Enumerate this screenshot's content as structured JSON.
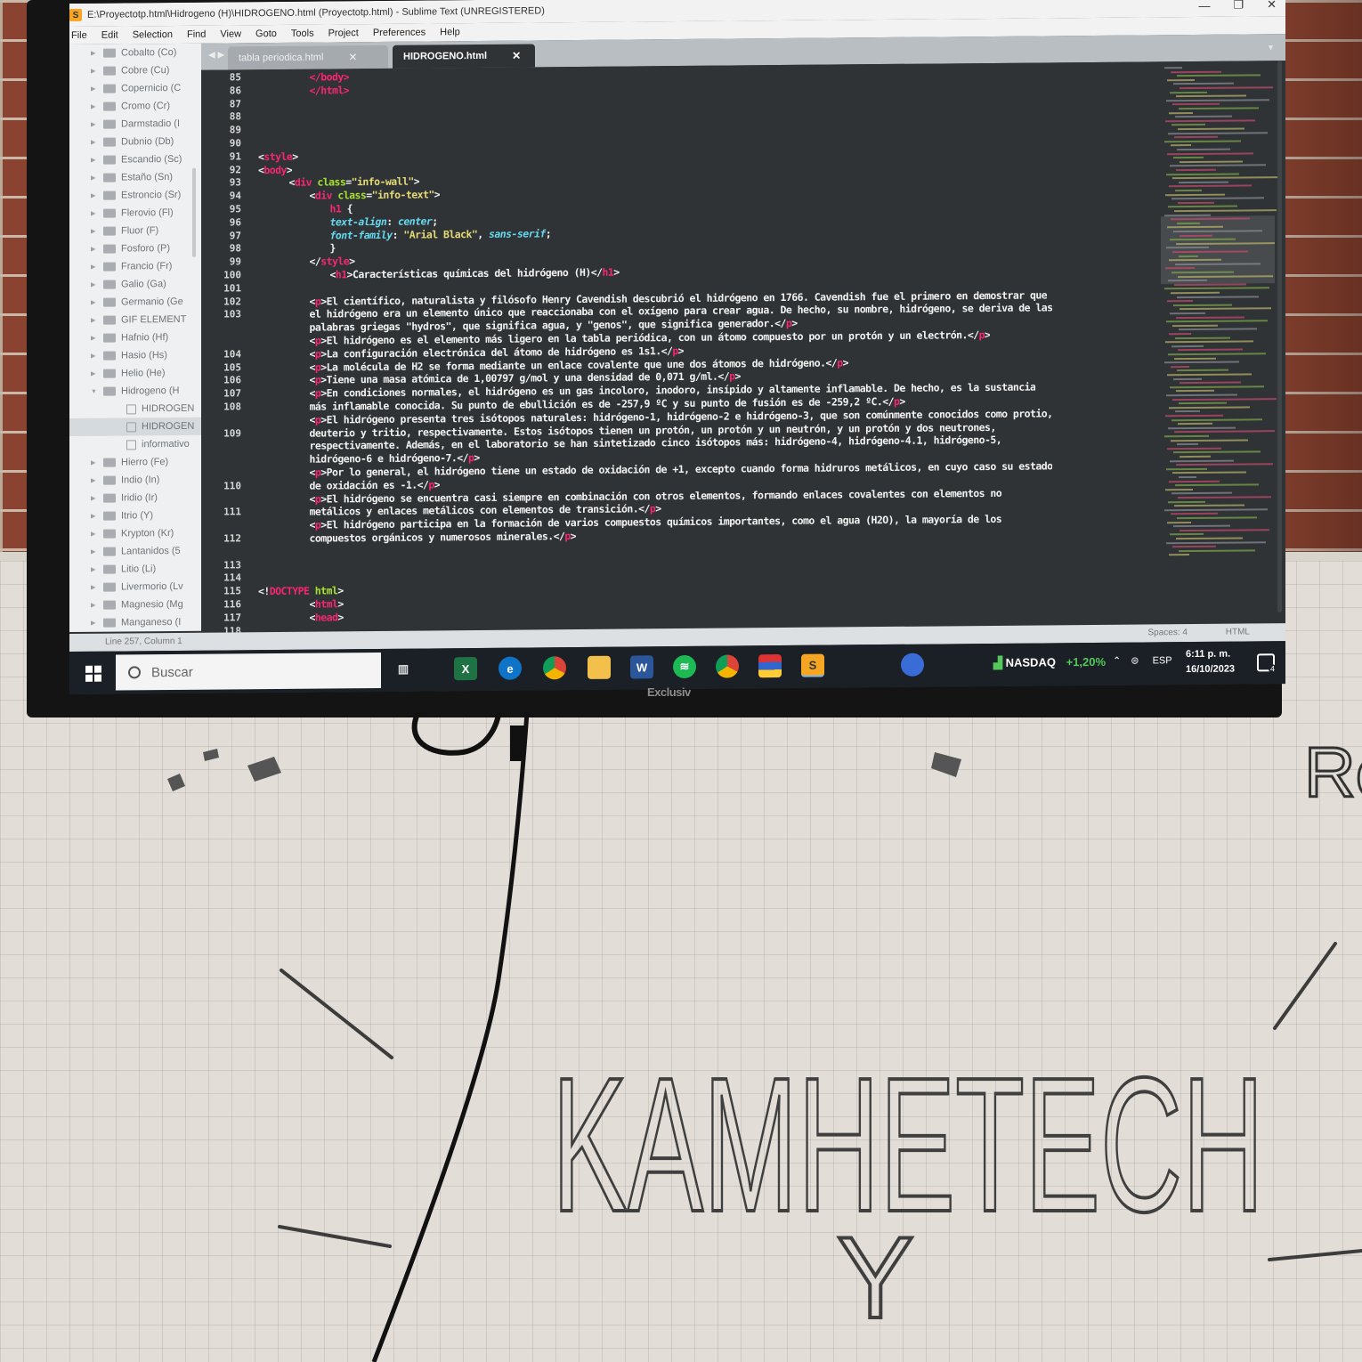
{
  "window": {
    "title": "E:\\Proyectotp.html\\Hidrogeno (H)\\HIDROGENO.html (Proyectotp.html) - Sublime Text (UNREGISTERED)",
    "minimize": "—",
    "maximize": "❐",
    "close": "✕"
  },
  "menu": [
    "File",
    "Edit",
    "Selection",
    "Find",
    "View",
    "Goto",
    "Tools",
    "Project",
    "Preferences",
    "Help"
  ],
  "sidebar": {
    "items": [
      {
        "label": "Cobalto (Co)",
        "type": "folder"
      },
      {
        "label": "Cobre (Cu)",
        "type": "folder"
      },
      {
        "label": "Copernicio (C",
        "type": "folder"
      },
      {
        "label": "Cromo (Cr)",
        "type": "folder"
      },
      {
        "label": "Darmstadio (I",
        "type": "folder"
      },
      {
        "label": "Dubnio (Db)",
        "type": "folder"
      },
      {
        "label": "Escandio (Sc)",
        "type": "folder"
      },
      {
        "label": "Estaño (Sn)",
        "type": "folder"
      },
      {
        "label": "Estroncio (Sr)",
        "type": "folder"
      },
      {
        "label": "Flerovio (Fl)",
        "type": "folder"
      },
      {
        "label": "Fluor (F)",
        "type": "folder"
      },
      {
        "label": "Fosforo (P)",
        "type": "folder"
      },
      {
        "label": "Francio (Fr)",
        "type": "folder"
      },
      {
        "label": "Galio (Ga)",
        "type": "folder"
      },
      {
        "label": "Germanio (Ge",
        "type": "folder"
      },
      {
        "label": "GIF ELEMENT",
        "type": "folder"
      },
      {
        "label": "Hafnio (Hf)",
        "type": "folder"
      },
      {
        "label": "Hasio (Hs)",
        "type": "folder"
      },
      {
        "label": "Helio (He)",
        "type": "folder"
      },
      {
        "label": "Hidrogeno (H",
        "type": "folder-open"
      },
      {
        "label": "HIDROGEN",
        "type": "file"
      },
      {
        "label": "HIDROGEN",
        "type": "file-selected"
      },
      {
        "label": "informativo",
        "type": "file"
      },
      {
        "label": "Hierro (Fe)",
        "type": "folder"
      },
      {
        "label": "Indio (In)",
        "type": "folder"
      },
      {
        "label": "Iridio (Ir)",
        "type": "folder"
      },
      {
        "label": "Itrio (Y)",
        "type": "folder"
      },
      {
        "label": "Krypton (Kr)",
        "type": "folder"
      },
      {
        "label": "Lantanidos (5",
        "type": "folder"
      },
      {
        "label": "Litio (Li)",
        "type": "folder"
      },
      {
        "label": "Livermorio (Lv",
        "type": "folder"
      },
      {
        "label": "Magnesio (Mg",
        "type": "folder"
      },
      {
        "label": "Manganeso (I",
        "type": "folder"
      }
    ]
  },
  "tabs": [
    {
      "label": "tabla periodica.html",
      "close": "✕"
    },
    {
      "label": "HIDROGENO.html",
      "close": "✕"
    }
  ],
  "code": {
    "line_numbers": [
      "85",
      "86",
      "87",
      "88",
      "89",
      "90",
      "91",
      "92",
      "93",
      "94",
      "95",
      "96",
      "97",
      "98",
      "99",
      "100",
      "101",
      "102",
      "103",
      "",
      "",
      "104",
      "105",
      "106",
      "107",
      "108",
      "",
      "109",
      "",
      "",
      "",
      "110",
      "",
      "111",
      "",
      "112",
      "",
      "113",
      "114",
      "115",
      "116",
      "117",
      "118"
    ],
    "lines": [
      {
        "indent": 5,
        "parts": [
          [
            "tag",
            "</body>"
          ]
        ]
      },
      {
        "indent": 5,
        "parts": [
          [
            "tag",
            "</html>"
          ]
        ]
      },
      {
        "indent": 0,
        "parts": []
      },
      {
        "indent": 0,
        "parts": []
      },
      {
        "indent": 0,
        "parts": []
      },
      {
        "indent": 0,
        "parts": []
      },
      {
        "indent": 0,
        "parts": [
          [
            "plain",
            "<"
          ],
          [
            "tag",
            "style"
          ],
          [
            "plain",
            ">"
          ]
        ]
      },
      {
        "indent": 0,
        "parts": [
          [
            "plain",
            "<"
          ],
          [
            "tag",
            "body"
          ],
          [
            "plain",
            ">"
          ]
        ]
      },
      {
        "indent": 3,
        "parts": [
          [
            "plain",
            "<"
          ],
          [
            "tag",
            "div "
          ],
          [
            "attr",
            "class"
          ],
          [
            "plain",
            "="
          ],
          [
            "str",
            "\"info-wall\""
          ],
          [
            "plain",
            ">"
          ]
        ]
      },
      {
        "indent": 5,
        "parts": [
          [
            "plain",
            "<"
          ],
          [
            "tag",
            "div "
          ],
          [
            "attr",
            "class"
          ],
          [
            "plain",
            "="
          ],
          [
            "str",
            "\"info-text\""
          ],
          [
            "plain",
            ">"
          ]
        ]
      },
      {
        "indent": 7,
        "parts": [
          [
            "tag",
            "h1"
          ],
          [
            "plain",
            " {"
          ]
        ]
      },
      {
        "indent": 7,
        "parts": [
          [
            "prop",
            "text-align"
          ],
          [
            "plain",
            ": "
          ],
          [
            "prop",
            "center"
          ],
          [
            "plain",
            ";"
          ]
        ]
      },
      {
        "indent": 7,
        "parts": [
          [
            "prop",
            "font-family"
          ],
          [
            "plain",
            ": "
          ],
          [
            "str",
            "\"Arial Black\""
          ],
          [
            "plain",
            ", "
          ],
          [
            "prop",
            "sans-serif"
          ],
          [
            "plain",
            ";"
          ]
        ]
      },
      {
        "indent": 7,
        "parts": [
          [
            "plain",
            "}"
          ]
        ]
      },
      {
        "indent": 5,
        "parts": [
          [
            "plain",
            "</"
          ],
          [
            "tag",
            "style"
          ],
          [
            "plain",
            ">"
          ]
        ]
      },
      {
        "indent": 7,
        "parts": [
          [
            "plain",
            "<"
          ],
          [
            "tag",
            "h1"
          ],
          [
            "plain",
            ">Características químicas del hidrógeno (H)</"
          ],
          [
            "tag",
            "h1"
          ],
          [
            "plain",
            ">"
          ]
        ]
      },
      {
        "indent": 0,
        "parts": []
      },
      {
        "indent": 5,
        "parts": [
          [
            "plain",
            "<"
          ],
          [
            "tag",
            "p"
          ],
          [
            "plain",
            ">El científico, naturalista y filósofo Henry Cavendish descubrió el hidrógeno en 1766. Cavendish fue el primero en demostrar que"
          ]
        ]
      },
      {
        "indent": 5,
        "parts": [
          [
            "plain",
            "el hidrógeno era un elemento único que reaccionaba con el oxígeno para crear agua. De hecho, su nombre, hidrógeno, se deriva de las"
          ]
        ]
      },
      {
        "indent": 5,
        "parts": [
          [
            "plain",
            "palabras griegas \"hydros\", que significa agua, y \"genos\", que significa generador.</"
          ],
          [
            "tag",
            "p"
          ],
          [
            "plain",
            ">"
          ]
        ]
      },
      {
        "indent": 5,
        "parts": [
          [
            "plain",
            "<"
          ],
          [
            "tag",
            "p"
          ],
          [
            "plain",
            ">El hidrógeno es el elemento más ligero en la tabla periódica, con un átomo compuesto por un protón y un electrón.</"
          ],
          [
            "tag",
            "p"
          ],
          [
            "plain",
            ">"
          ]
        ]
      },
      {
        "indent": 5,
        "parts": [
          [
            "plain",
            "<"
          ],
          [
            "tag",
            "p"
          ],
          [
            "plain",
            ">La configuración electrónica del átomo de hidrógeno es 1s1.</"
          ],
          [
            "tag",
            "p"
          ],
          [
            "plain",
            ">"
          ]
        ]
      },
      {
        "indent": 5,
        "parts": [
          [
            "plain",
            "<"
          ],
          [
            "tag",
            "p"
          ],
          [
            "plain",
            ">La molécula de H2 se forma mediante un enlace covalente que une dos átomos de hidrógeno.</"
          ],
          [
            "tag",
            "p"
          ],
          [
            "plain",
            ">"
          ]
        ]
      },
      {
        "indent": 5,
        "parts": [
          [
            "plain",
            "<"
          ],
          [
            "tag",
            "p"
          ],
          [
            "plain",
            ">Tiene una masa atómica de 1,00797 g/mol y una densidad de 0,071 g/ml.</"
          ],
          [
            "tag",
            "p"
          ],
          [
            "plain",
            ">"
          ]
        ]
      },
      {
        "indent": 5,
        "parts": [
          [
            "plain",
            "<"
          ],
          [
            "tag",
            "p"
          ],
          [
            "plain",
            ">En condiciones normales, el hidrógeno es un gas incoloro, inodoro, insípido y altamente inflamable. De hecho, es la sustancia"
          ]
        ]
      },
      {
        "indent": 5,
        "parts": [
          [
            "plain",
            "más inflamable conocida. Su punto de ebullición es de -257,9 ºC y su punto de fusión es de -259,2 ºC.</"
          ],
          [
            "tag",
            "p"
          ],
          [
            "plain",
            ">"
          ]
        ]
      },
      {
        "indent": 5,
        "parts": [
          [
            "plain",
            "<"
          ],
          [
            "tag",
            "p"
          ],
          [
            "plain",
            ">El hidrógeno presenta tres isótopos naturales: hidrógeno-1, hidrógeno-2 e hidrógeno-3, que son comúnmente conocidos como protio,"
          ]
        ]
      },
      {
        "indent": 5,
        "parts": [
          [
            "plain",
            "deuterio y tritio, respectivamente. Estos isótopos tienen un protón, un protón y un neutrón, y un protón y dos neutrones,"
          ]
        ]
      },
      {
        "indent": 5,
        "parts": [
          [
            "plain",
            "respectivamente. Además, en el laboratorio se han sintetizado cinco isótopos más: hidrógeno-4, hidrógeno-4.1, hidrógeno-5,"
          ]
        ]
      },
      {
        "indent": 5,
        "parts": [
          [
            "plain",
            "hidrógeno-6 e hidrógeno-7.</"
          ],
          [
            "tag",
            "p"
          ],
          [
            "plain",
            ">"
          ]
        ]
      },
      {
        "indent": 5,
        "parts": [
          [
            "plain",
            "<"
          ],
          [
            "tag",
            "p"
          ],
          [
            "plain",
            ">Por lo general, el hidrógeno tiene un estado de oxidación de +1, excepto cuando forma hidruros metálicos, en cuyo caso su estado"
          ]
        ]
      },
      {
        "indent": 5,
        "parts": [
          [
            "plain",
            "de oxidación es -1.</"
          ],
          [
            "tag",
            "p"
          ],
          [
            "plain",
            ">"
          ]
        ]
      },
      {
        "indent": 5,
        "parts": [
          [
            "plain",
            "<"
          ],
          [
            "tag",
            "p"
          ],
          [
            "plain",
            ">El hidrógeno se encuentra casi siempre en combinación con otros elementos, formando enlaces covalentes con elementos no"
          ]
        ]
      },
      {
        "indent": 5,
        "parts": [
          [
            "plain",
            "metálicos y enlaces metálicos con elementos de transición.</"
          ],
          [
            "tag",
            "p"
          ],
          [
            "plain",
            ">"
          ]
        ]
      },
      {
        "indent": 5,
        "parts": [
          [
            "plain",
            "<"
          ],
          [
            "tag",
            "p"
          ],
          [
            "plain",
            ">El hidrógeno participa en la formación de varios compuestos químicos importantes, como el agua (H2O), la mayoría de los"
          ]
        ]
      },
      {
        "indent": 5,
        "parts": [
          [
            "plain",
            "compuestos orgánicos y numerosos minerales.</"
          ],
          [
            "tag",
            "p"
          ],
          [
            "plain",
            ">"
          ]
        ]
      },
      {
        "indent": 0,
        "parts": []
      },
      {
        "indent": 0,
        "parts": []
      },
      {
        "indent": 0,
        "parts": []
      },
      {
        "indent": 0,
        "parts": [
          [
            "plain",
            "<!"
          ],
          [
            "tag",
            "DOCTYPE "
          ],
          [
            "attr",
            "html"
          ],
          [
            "plain",
            ">"
          ]
        ]
      },
      {
        "indent": 5,
        "parts": [
          [
            "plain",
            "<"
          ],
          [
            "tag",
            "html"
          ],
          [
            "plain",
            ">"
          ]
        ]
      },
      {
        "indent": 5,
        "parts": [
          [
            "plain",
            "<"
          ],
          [
            "tag",
            "head"
          ],
          [
            "plain",
            ">"
          ]
        ]
      }
    ]
  },
  "status": {
    "position": "Line 257, Column 1",
    "spaces": "Spaces: 4",
    "syntax": "HTML"
  },
  "taskbar": {
    "search_placeholder": "Buscar",
    "nasdaq_label": "NASDAQ",
    "nasdaq_change": "+1,20%",
    "language": "ESP",
    "time": "6:11 p. m.",
    "date": "16/10/2023",
    "notifications": "4"
  },
  "monitor_brand": "Exclusiv",
  "whiteboard": {
    "main_text": "KAMHETECH",
    "sub_text": "Y",
    "corner_text": "Re"
  },
  "colors": {
    "editor_bg": "#2f3336",
    "tag": "#f92672",
    "attr": "#a6e22e",
    "string": "#e6db74",
    "property": "#66d9ef"
  }
}
